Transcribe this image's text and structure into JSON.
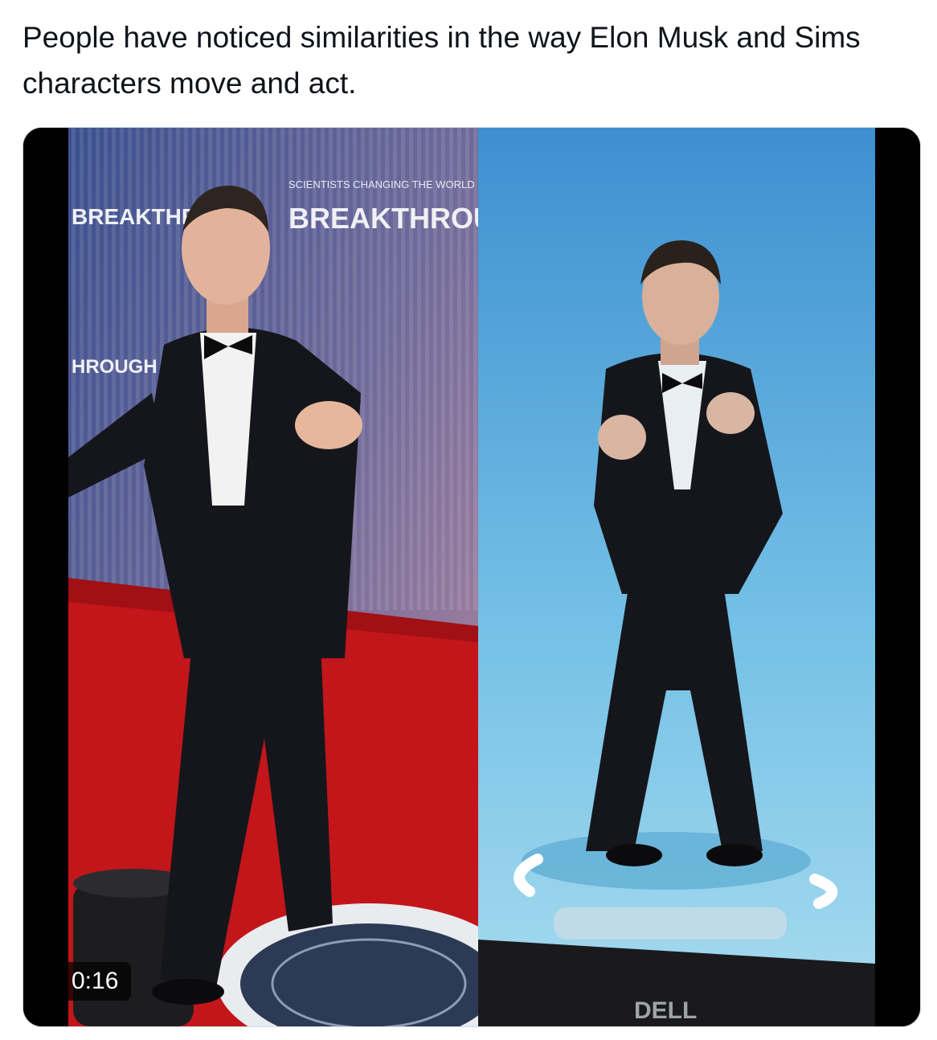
{
  "tweet": {
    "text": "People have noticed similarities in the way Elon Musk and Sims characters move and act."
  },
  "media": {
    "duration": "0:16",
    "backdrop_text_large": "BREAKTHROUGH PRIZE",
    "backdrop_text_small": "SCIENTISTS CHANGING THE WORLD",
    "floor_text": "BREAKTHROUGH",
    "monitor_brand": "DELL",
    "colors": {
      "backdrop": "#6f6a9a",
      "carpet": "#c2161b",
      "sims_background": "#5fb0dc",
      "suit": "#15161b"
    }
  }
}
